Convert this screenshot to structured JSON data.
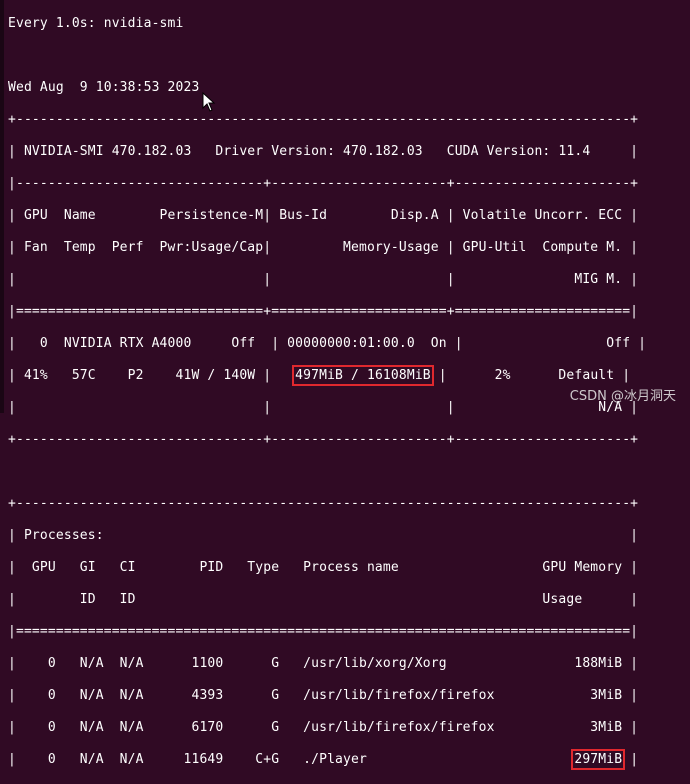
{
  "header": {
    "watch": "Every 1.0s: nvidia-smi",
    "datetime": "Wed Aug  9 10:38:53 2023"
  },
  "table": {
    "border_top": "+-----------------------------------------------------------------------------+",
    "smi_line": "| NVIDIA-SMI 470.182.03   Driver Version: 470.182.03   CUDA Version: 11.4     |",
    "sep_dash": "|-------------------------------+----------------------+----------------------+",
    "hdr1": "| GPU  Name        Persistence-M| Bus-Id        Disp.A | Volatile Uncorr. ECC |",
    "hdr2": "| Fan  Temp  Perf  Pwr:Usage/Cap|         Memory-Usage | GPU-Util  Compute M. |",
    "hdr3": "|                               |                      |               MIG M. |",
    "sep_eq": "|===============================+======================+======================|",
    "gpu_row1": "|   0  NVIDIA RTX A4000     Off  | 00000000:01:00.0  On |                  Off |",
    "gpu_row2_a": "| 41%   57C    P2    41W / 140W |   ",
    "gpu_memory_usage": "497MiB / 16108MiB",
    "gpu_row2_b": " |      2%      Default |",
    "gpu_row3": "|                               |                      |                  N/A |",
    "border_mid": "+-------------------------------+----------------------+----------------------+",
    "blank": " ",
    "proc_border_top": "+-----------------------------------------------------------------------------+",
    "proc_title": "| Processes:                                                                  |",
    "proc_hdr1": "|  GPU   GI   CI        PID   Type   Process name                  GPU Memory |",
    "proc_hdr2": "|        ID   ID                                                   Usage      |",
    "proc_eq": "|=============================================================================|",
    "proc1": "|    0   N/A  N/A      1100      G   /usr/lib/xorg/Xorg                188MiB |",
    "proc2": "|    0   N/A  N/A      4393      G   /usr/lib/firefox/firefox            3MiB |",
    "proc3": "|    0   N/A  N/A      6170      G   /usr/lib/firefox/firefox            3MiB |",
    "proc4_a": "|    0   N/A  N/A     11649    C+G   ./Player                          ",
    "proc4_mem": "297MiB",
    "proc4_b": " |"
  },
  "watermark": "CSDN @冰月洞天"
}
